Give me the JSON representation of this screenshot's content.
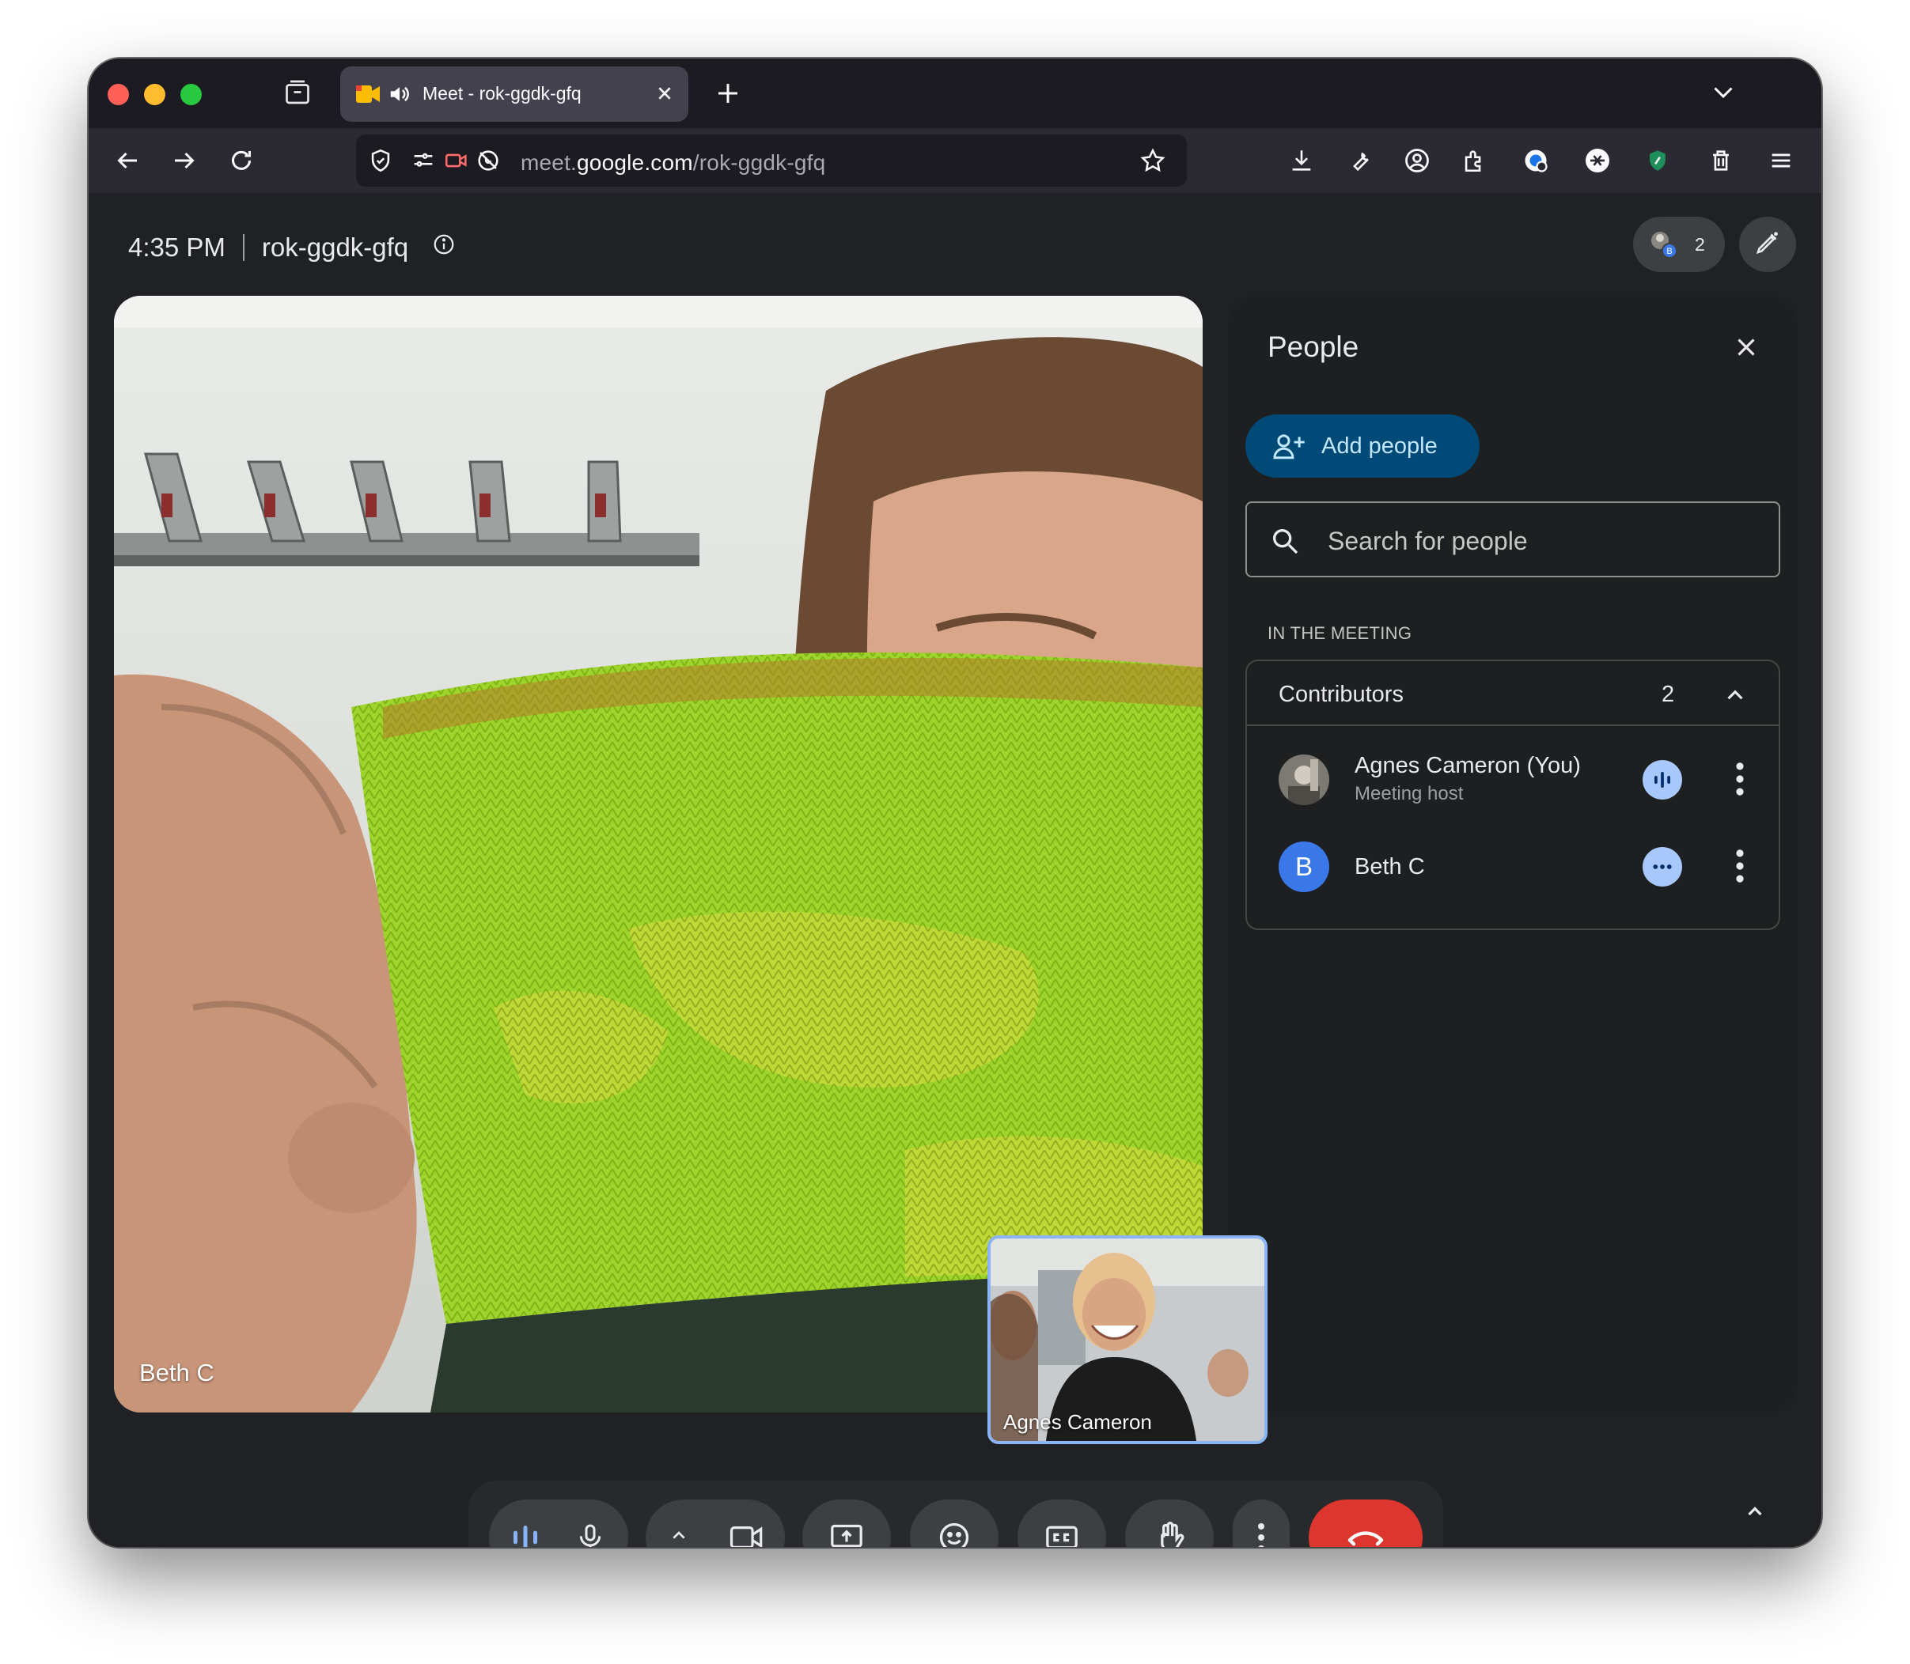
{
  "browser": {
    "tab_title": "Meet - rok-ggdk-gfq",
    "url_prefix": "meet.",
    "url_host": "google.com",
    "url_path": "/rok-ggdk-gfq"
  },
  "meeting": {
    "time": "4:35 PM",
    "code": "rok-ggdk-gfq",
    "participant_count": "2",
    "avatar_badge": "B"
  },
  "video": {
    "main_label": "Beth C",
    "pip_label": "Agnes Cameron"
  },
  "people_panel": {
    "title": "People",
    "add_people_label": "Add people",
    "search_placeholder": "Search for people",
    "section_label": "IN THE MEETING",
    "group_title": "Contributors",
    "group_count": "2",
    "participants": [
      {
        "name": "Agnes Cameron (You)",
        "role": "Meeting host",
        "status_icon": "audio-level-icon"
      },
      {
        "name": "Beth C",
        "initial": "B",
        "status_icon": "more-options-dots-icon"
      }
    ]
  },
  "colors": {
    "end_call": "#dc362e",
    "add_people_bg": "#004a77",
    "accent_blue": "#a8c7fa",
    "avatar_blue": "#3b78e7"
  }
}
